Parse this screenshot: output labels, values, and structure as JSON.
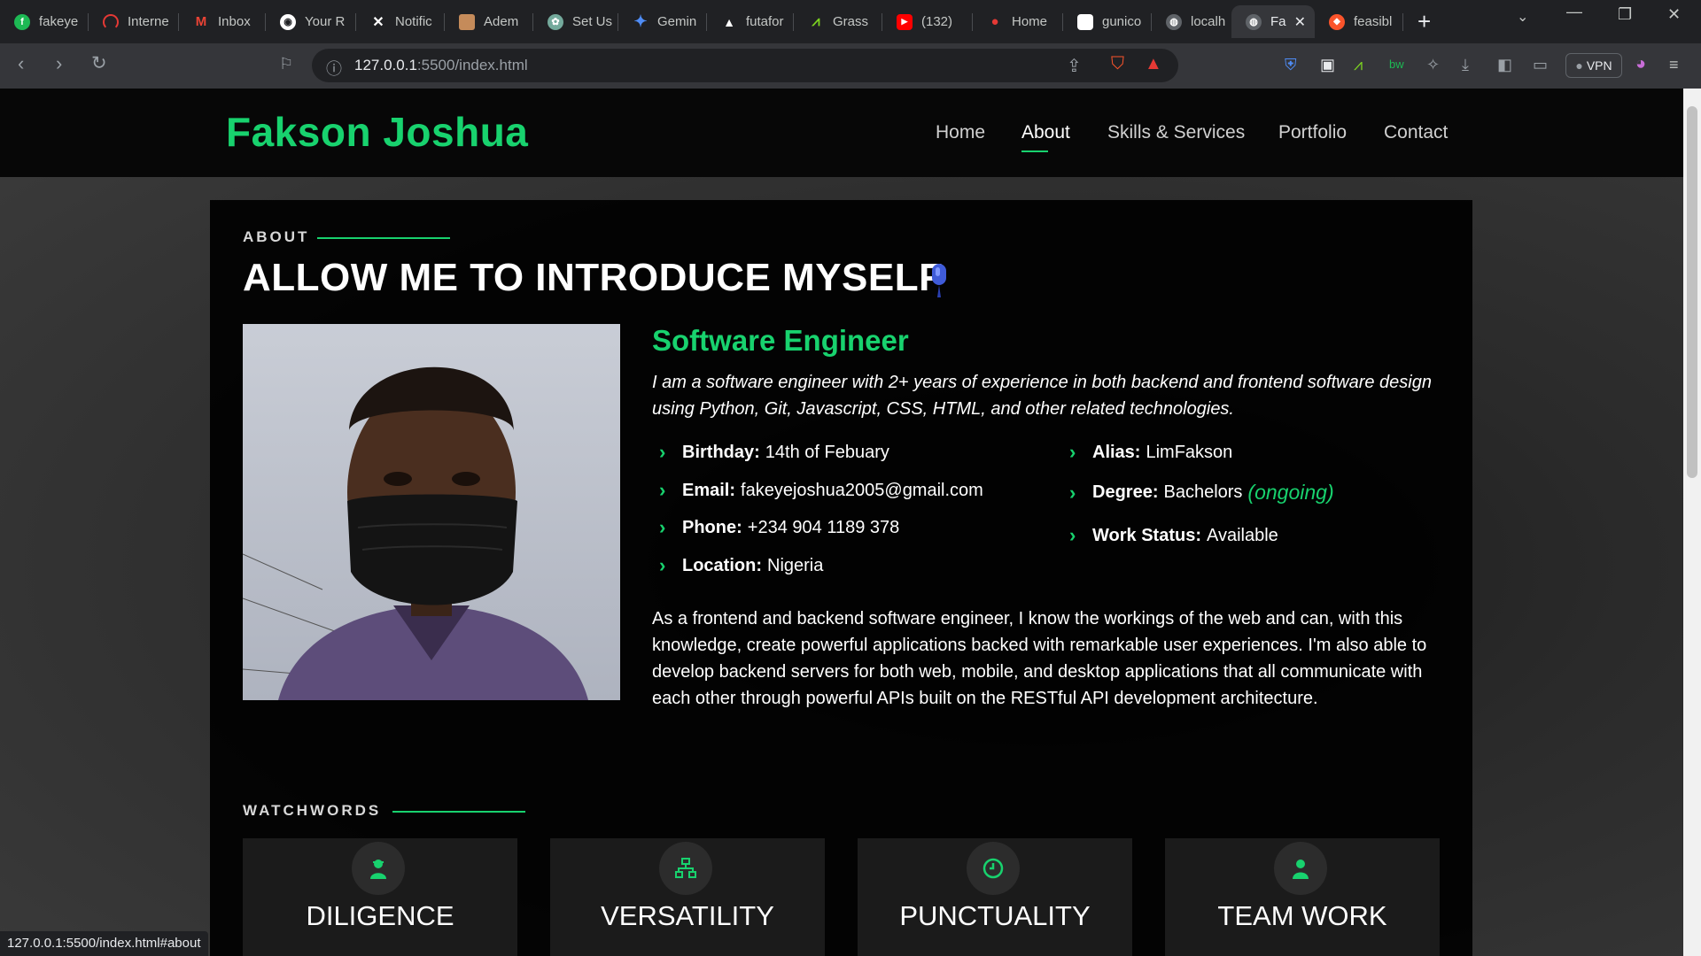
{
  "browser": {
    "tabs": [
      {
        "label": "fakeye",
        "icon": "green-f-icon",
        "color": "#1db954"
      },
      {
        "label": "Interne",
        "icon": "speedometer-icon",
        "color": "#e53935"
      },
      {
        "label": "Inbox",
        "icon": "gmail-icon",
        "color": "#ea4335"
      },
      {
        "label": "Your R",
        "icon": "github-icon",
        "color": "#ffffff"
      },
      {
        "label": "Notific",
        "icon": "x-icon",
        "color": "#ffffff"
      },
      {
        "label": "Adem",
        "icon": "avatar-icon",
        "color": "#c58b5a"
      },
      {
        "label": "Set Us",
        "icon": "chatgpt-icon",
        "color": "#74aa9c"
      },
      {
        "label": "Gemin",
        "icon": "gemini-icon",
        "color": "#4f8df7"
      },
      {
        "label": "futafor",
        "icon": "triangle-icon",
        "color": "#ffffff"
      },
      {
        "label": "Grass",
        "icon": "grass-icon",
        "color": "#7cd320"
      },
      {
        "label": "(132)",
        "icon": "youtube-icon",
        "color": "#ff0000"
      },
      {
        "label": "Home",
        "icon": "pin-icon",
        "color": "#e53935"
      },
      {
        "label": "gunico",
        "icon": "hexagon-icon",
        "color": "#ffffff"
      },
      {
        "label": "localh",
        "icon": "globe-icon",
        "color": "#c4c7c5"
      },
      {
        "label": "Fa",
        "icon": "globe-icon",
        "color": "#c4c7c5",
        "active": true
      },
      {
        "label": "feasibl",
        "icon": "brave-icon",
        "color": "#fb542b"
      }
    ],
    "url_host": "127.0.0.1",
    "url_rest": ":5500/index.html",
    "vpn_label": "VPN",
    "status_url": "127.0.0.1:5500/index.html#about"
  },
  "site": {
    "logo": "Fakson Joshua",
    "nav": [
      "Home",
      "About",
      "Skills & Services",
      "Portfolio",
      "Contact"
    ],
    "active_nav": "About",
    "accent": "#18d26e"
  },
  "about": {
    "label": "ABOUT",
    "heading": "ALLOW ME TO INTRODUCE MYSELF",
    "role": "Software Engineer",
    "intro": "I am a software engineer with 2+ years of experience in both backend and frontend software design using Python, Git, Javascript, CSS, HTML, and other related technologies.",
    "facts_left": [
      {
        "key": "Birthday:",
        "value": "14th of Febuary"
      },
      {
        "key": "Email:",
        "value": "fakeyejoshua2005@gmail.com"
      },
      {
        "key": "Phone:",
        "value": "+234 904 1189 378"
      },
      {
        "key": "Location:",
        "value": "Nigeria"
      }
    ],
    "facts_right": [
      {
        "key": "Alias:",
        "value": "LimFakson"
      },
      {
        "key": "Degree:",
        "value": "Bachelors",
        "note": "(ongoing)"
      },
      {
        "key": "Work Status:",
        "value": "Available"
      }
    ],
    "description": "As a frontend and backend software engineer, I know the workings of the web and can, with this knowledge, create powerful applications backed with remarkable user experiences. I'm also able to develop backend servers for both web, mobile, and desktop applications that all communicate with each other through powerful APIs built on the RESTful API development architecture."
  },
  "watchwords": {
    "label": "WATCHWORDS",
    "items": [
      {
        "title": "DILIGENCE",
        "icon": "worker-icon"
      },
      {
        "title": "VERSATILITY",
        "icon": "sitemap-icon"
      },
      {
        "title": "PUNCTUALITY",
        "icon": "clock-icon"
      },
      {
        "title": "TEAM WORK",
        "icon": "person-icon"
      }
    ]
  }
}
